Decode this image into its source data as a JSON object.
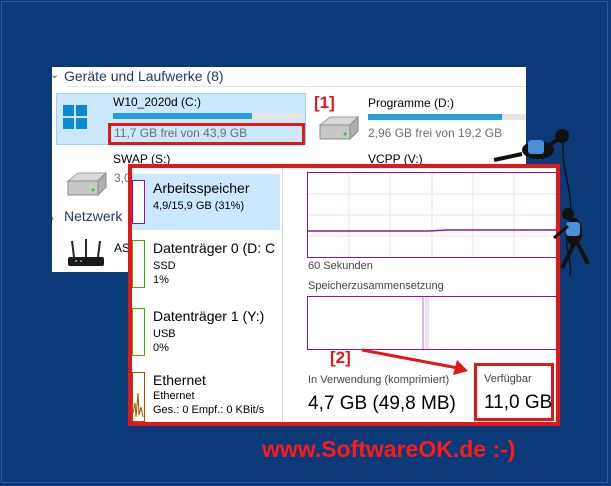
{
  "explorer": {
    "section_devices": "Geräte und Laufwerke (8)",
    "section_network": "Netzwerk",
    "drives": [
      {
        "name": "W10_2020d (C:)",
        "free": "11,7 GB frei von 43,9 GB",
        "used_fraction": 0.73,
        "selected": true
      },
      {
        "name": "Programme (D:)",
        "free": "2,96 GB frei von 19,2 GB",
        "used_fraction": 0.85
      },
      {
        "name": "SWAP (S:)",
        "free": "3,0"
      },
      {
        "name": "VCPP (V:)"
      }
    ],
    "network_item_partial": "AS"
  },
  "callouts": {
    "one": "[1]",
    "two": "[2]"
  },
  "taskmanager": {
    "sidebar": [
      {
        "title": "Arbeitsspeicher",
        "line1": "4,9/15,9 GB (31%)"
      },
      {
        "title": "Datenträger 0 (D: C",
        "line1": "SSD",
        "line2": "1%"
      },
      {
        "title": "Datenträger 1 (Y:)",
        "line1": "USB",
        "line2": "0%"
      },
      {
        "title": "Ethernet",
        "line1": "Ethernet",
        "line2": "Ges.: 0 Empf.: 0 KBit/s"
      }
    ],
    "graph_time_label": "60 Sekunden",
    "composition_label": "Speicherzusammensetzung",
    "in_use_label": "In Verwendung (komprimiert)",
    "in_use_value": "4,7 GB (49,8 MB)",
    "available_label": "Verfügbar",
    "available_value": "11,0 GB"
  },
  "watermark": "www.SoftwareOK.de :-)",
  "colors": {
    "background": "#0b3a78",
    "accent_red": "#e01818",
    "memory_purple": "#8b12ae",
    "drive_bar": "#26a0da"
  }
}
